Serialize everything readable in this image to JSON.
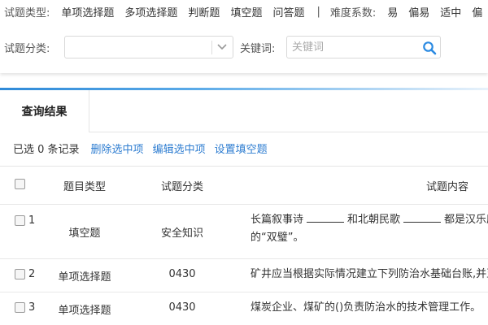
{
  "filters": {
    "type_label": "试题类型:",
    "types": [
      "单项选择题",
      "多项选择题",
      "判断题",
      "填空题",
      "问答题"
    ],
    "separator": "|",
    "difficulty_label": "难度系数:",
    "difficulties": [
      "易",
      "偏易",
      "适中",
      "偏"
    ],
    "category_label": "试题分类:",
    "category_value": "",
    "keyword_label": "关键词:",
    "keyword_placeholder": "关键词",
    "keyword_value": ""
  },
  "tab": {
    "label": "查询结果"
  },
  "actions": {
    "selected_count": "已选 0 条记录",
    "links": [
      "删除选中项",
      "编辑选中项",
      "设置填空题"
    ]
  },
  "table": {
    "headers": {
      "type": "题目类型",
      "category": "试题分类",
      "content": "试题内容"
    },
    "rows": [
      {
        "index": "1",
        "type": "填空题",
        "category": "安全知识",
        "content_parts": [
          "长篇叙事诗",
          "和北朝民歌",
          "都是汉乐府中"
        ],
        "content_line2": "的“双璧”。"
      },
      {
        "index": "2",
        "type": "单项选择题",
        "category": "0430",
        "content": "矿井应当根据实际情况建立下列防治水基础台账,并至"
      },
      {
        "index": "3",
        "type": "单项选择题",
        "category": "0430",
        "content": "煤炭企业、煤矿的()负责防治水的技术管理工作。"
      }
    ]
  },
  "colors": {
    "link": "#2e7dd1",
    "accent": "#2f8ad8",
    "search_icon": "#2b8ae2"
  }
}
